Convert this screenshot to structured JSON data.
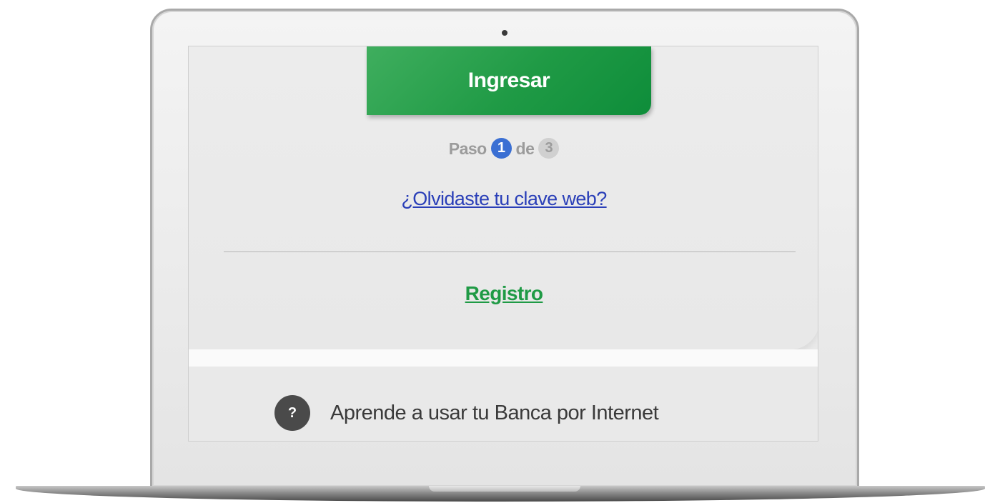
{
  "login": {
    "submit_label": "Ingresar",
    "step": {
      "prefix": "Paso",
      "current": "1",
      "separator": "de",
      "total": "3"
    },
    "forgot_link": "¿Olvidaste tu clave web?",
    "register_link": "Registro"
  },
  "help": {
    "icon_glyph": "?",
    "text": "Aprende a usar tu Banca por Internet"
  },
  "colors": {
    "primary_green": "#1f9a45",
    "link_blue": "#2a3fb8",
    "step_active": "#3a6fd3",
    "step_inactive": "#d0d0d0"
  },
  "icons": {
    "help": "question-circle-icon",
    "camera": "webcam-dot"
  }
}
